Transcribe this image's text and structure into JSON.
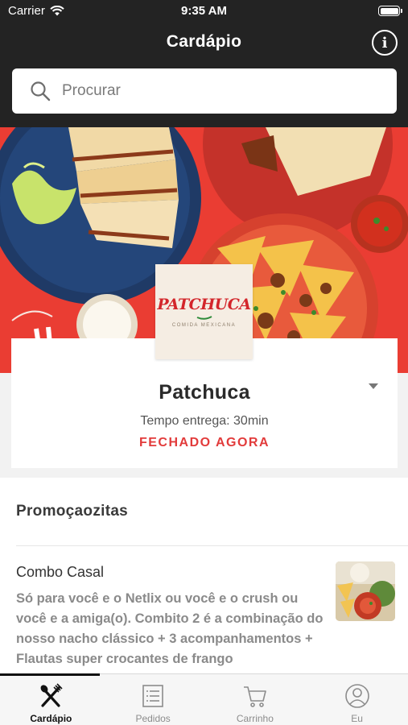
{
  "status_bar": {
    "carrier": "Carrier",
    "time": "9:35 AM"
  },
  "header": {
    "title": "Cardápio",
    "info_icon": "info-icon",
    "info_glyph": "i"
  },
  "search": {
    "placeholder": "Procurar",
    "icon": "search-icon"
  },
  "restaurant": {
    "logo_text": "PATCHUCA",
    "logo_subtitle": "COMIDA MEXICANA",
    "name": "Patchuca",
    "delivery_time": "Tempo entrega: 30min",
    "status": "FECHADO AGORA",
    "status_color": "#e23b3b"
  },
  "promotions": {
    "heading": "Promoçaozitas",
    "items": [
      {
        "title": "Combo Casal",
        "description": "Só para você e o Netlix ou você e o crush ou você e a amiga(o). Combito 2 é a combinação do nosso nacho clássico + 3 acompanhamentos + Flautas super crocantes de frango"
      }
    ]
  },
  "tabs": [
    {
      "label": "Cardápio",
      "icon": "fork-knife-icon",
      "active": true
    },
    {
      "label": "Pedidos",
      "icon": "list-icon",
      "active": false
    },
    {
      "label": "Carrinho",
      "icon": "cart-icon",
      "active": false
    },
    {
      "label": "Eu",
      "icon": "user-icon",
      "active": false
    }
  ],
  "colors": {
    "header_bg": "#232323",
    "hero_bg": "#ea3d33",
    "accent_red": "#e23b3b"
  }
}
